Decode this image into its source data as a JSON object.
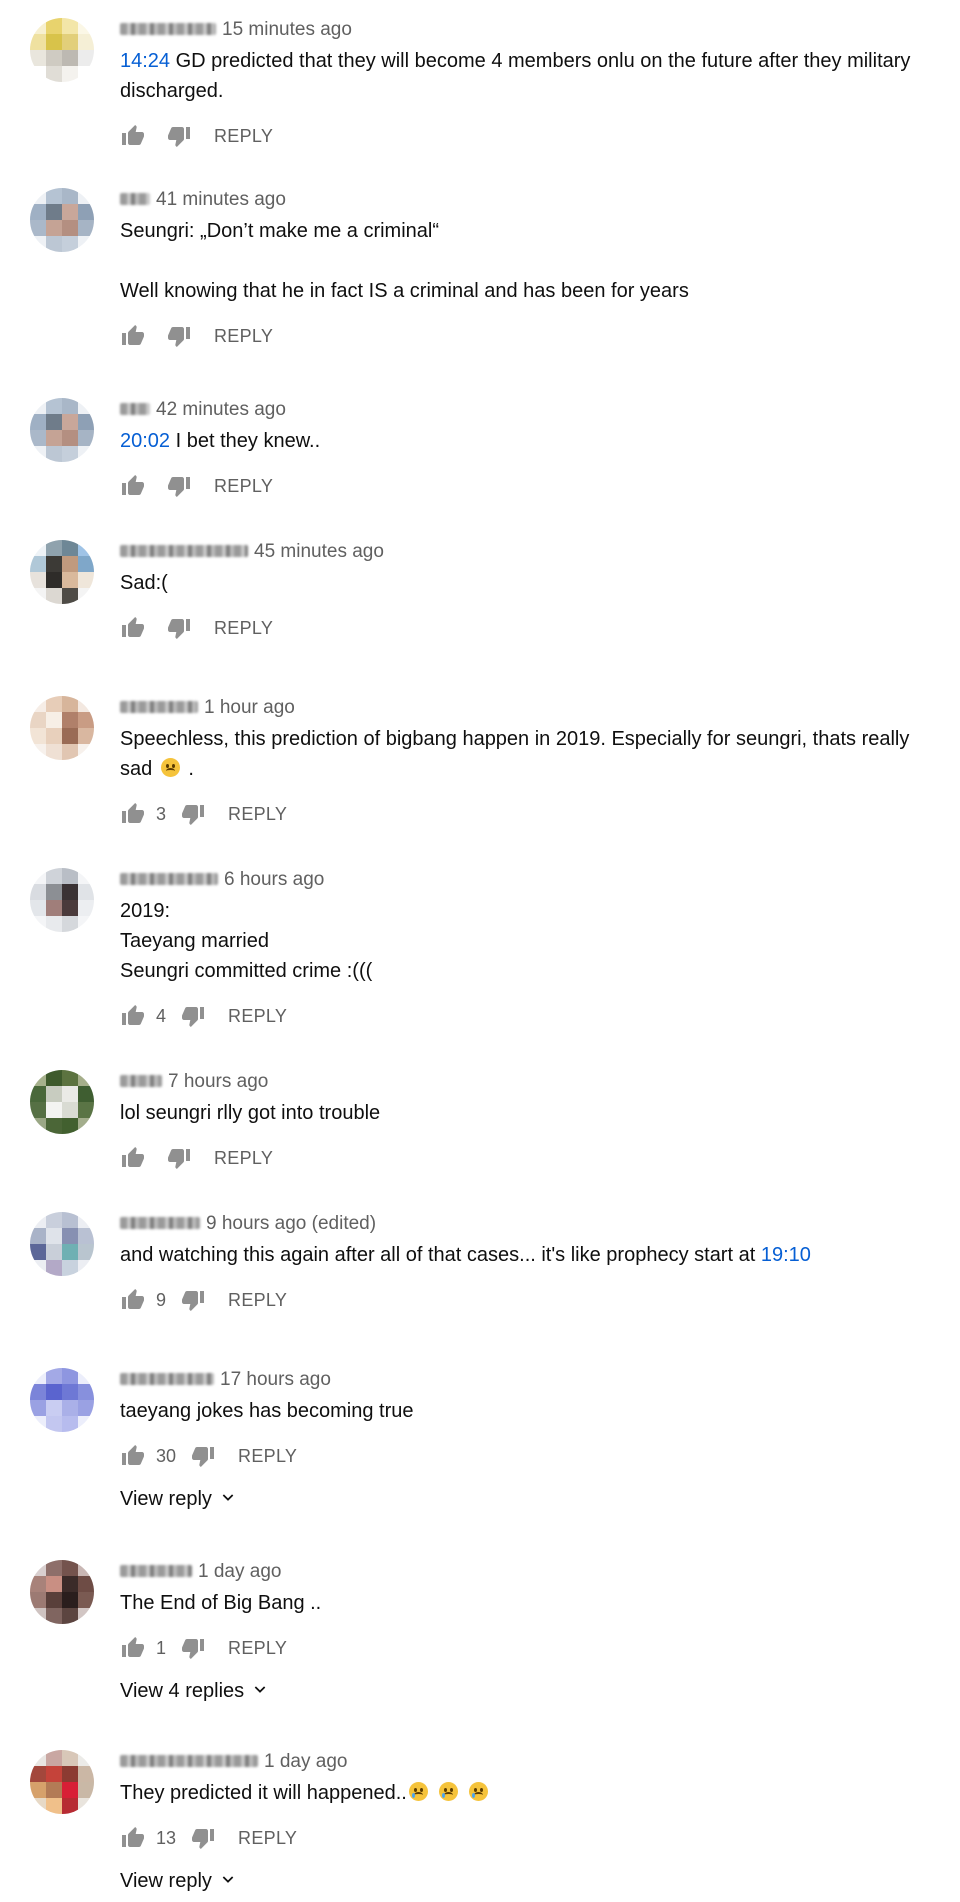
{
  "labels": {
    "reply": "REPLY"
  },
  "comments": [
    {
      "time": "15 minutes ago",
      "name_blur_width": 96,
      "avatar_palette": [
        "#f7f0cf",
        "#e8d36d",
        "#f3e6a8",
        "#fbf7e6",
        "#efe1a0",
        "#d8c34a",
        "#e2cf7a",
        "#f5efd6",
        "#e9e6dd",
        "#cfcbc2",
        "#bdb9b2",
        "#ececec",
        "#ffffff",
        "#e0ddd6",
        "#f4f2ee",
        "#ffffff"
      ],
      "lines": [
        {
          "ts": "14:24",
          "text": " GD predicted that they will become 4 members onlu on the future after they military discharged."
        }
      ],
      "likes": ""
    },
    {
      "time": "41 minutes ago",
      "name_blur_width": 30,
      "avatar_palette": [
        "#eef1f5",
        "#b5c3d3",
        "#a9b7c8",
        "#eef1f5",
        "#9fb0c4",
        "#6f7c8a",
        "#c9a79a",
        "#8ea0b5",
        "#aab8c9",
        "#c5a395",
        "#b48f81",
        "#a6b4c5",
        "#eef1f5",
        "#bcc7d4",
        "#c5cfdb",
        "#eef1f5"
      ],
      "lines": [
        {
          "text": "Seungri: „Don’t make me a criminal“"
        },
        {
          "blank": true
        },
        {
          "text": "Well knowing that he in fact IS a criminal and has been for years"
        }
      ],
      "likes": ""
    },
    {
      "time": "42 minutes ago",
      "name_blur_width": 30,
      "avatar_palette": [
        "#eef1f5",
        "#b5c3d3",
        "#a9b7c8",
        "#eef1f5",
        "#9fb0c4",
        "#6f7c8a",
        "#c9a79a",
        "#8ea0b5",
        "#aab8c9",
        "#c5a395",
        "#b48f81",
        "#a6b4c5",
        "#eef1f5",
        "#bcc7d4",
        "#c5cfdb",
        "#eef1f5"
      ],
      "lines": [
        {
          "ts": "20:02",
          "text": " I bet they knew.."
        }
      ],
      "likes": ""
    },
    {
      "time": "45 minutes ago",
      "name_blur_width": 128,
      "avatar_palette": [
        "#eef3f7",
        "#8fa2ad",
        "#6e8796",
        "#9fc3e6",
        "#b0c8d8",
        "#3c3a36",
        "#c09a7e",
        "#7fa7c9",
        "#e7e2dc",
        "#2e2c29",
        "#d9b99c",
        "#efe6da",
        "#f4f4f4",
        "#dcd8d2",
        "#4e4b46",
        "#f4f4f4"
      ],
      "lines": [
        {
          "text": "Sad:("
        }
      ],
      "likes": ""
    },
    {
      "time": "1 hour ago",
      "name_blur_width": 78,
      "avatar_palette": [
        "#f6ede6",
        "#e7cdb8",
        "#d7b59b",
        "#f3e8e0",
        "#e9d5c4",
        "#f7efe6",
        "#b0806a",
        "#c99c84",
        "#f2e4d6",
        "#e8d0bc",
        "#9a6b55",
        "#d9b7a0",
        "#f7f1ec",
        "#efe0d4",
        "#e1c6b2",
        "#f7f1ec"
      ],
      "lines": [
        {
          "text": "Speechless, this prediction of bigbang happen in 2019. Especially for seungri, thats really sad ",
          "emoji": "sad",
          "tail": " ."
        }
      ],
      "likes": "3"
    },
    {
      "time": "6 hours ago",
      "name_blur_width": 98,
      "avatar_palette": [
        "#f4f5f7",
        "#cfd3d9",
        "#b9bec6",
        "#f4f5f7",
        "#d9dce1",
        "#8c8f94",
        "#3a3234",
        "#e0e3e7",
        "#e3e6ea",
        "#a07e7a",
        "#4a3a3b",
        "#eceef1",
        "#f4f5f7",
        "#e8eaed",
        "#d5d8dc",
        "#f4f5f7"
      ],
      "lines": [
        {
          "text": "2019:"
        },
        {
          "text": "Taeyang married"
        },
        {
          "text": "Seungri committed crime :((("
        }
      ],
      "likes": "4"
    },
    {
      "time": "7 hours ago",
      "name_blur_width": 42,
      "avatar_palette": [
        "#a6b18c",
        "#3e5a2c",
        "#5c7340",
        "#a5ae8a",
        "#49683a",
        "#c8ccc0",
        "#eaeae6",
        "#3f5e31",
        "#567044",
        "#f4f4f2",
        "#d9dbd3",
        "#5a7445",
        "#9aa785",
        "#4b6637",
        "#42602f",
        "#a3ad8c"
      ],
      "lines": [
        {
          "text": "lol seungri rlly got into trouble"
        }
      ],
      "likes": ""
    },
    {
      "time": "9 hours ago (edited)",
      "name_blur_width": 80,
      "avatar_palette": [
        "#eceef3",
        "#c9cfdc",
        "#b8c0d2",
        "#eceef3",
        "#a9b3c8",
        "#dfe3ea",
        "#8790b2",
        "#b9c1d3",
        "#5c6798",
        "#c9cfd9",
        "#6fb0b3",
        "#b9c5cf",
        "#eceef3",
        "#b3a9c7",
        "#c8d2de",
        "#eceef3"
      ],
      "lines": [
        {
          "text": "and watching this again after all of that cases... it's like prophecy start at ",
          "ts_end": "19:10"
        }
      ],
      "likes": "9"
    },
    {
      "time": "17 hours ago",
      "name_blur_width": 94,
      "avatar_palette": [
        "#eceefb",
        "#a3a9e6",
        "#8e96e0",
        "#eceefb",
        "#7b84d9",
        "#5a64cf",
        "#6e78d5",
        "#8790dd",
        "#9aa1e3",
        "#c9cdf2",
        "#aab0e8",
        "#9aa1e3",
        "#eceefb",
        "#c3c7f0",
        "#b7bcee",
        "#eceefb"
      ],
      "lines": [
        {
          "text": "taeyang jokes has becoming true"
        }
      ],
      "likes": "30",
      "view_replies": "View reply"
    },
    {
      "time": "1 day ago",
      "name_blur_width": 72,
      "avatar_palette": [
        "#d9cfcf",
        "#8e6f6a",
        "#74534d",
        "#c9b7b4",
        "#a8827a",
        "#c98f83",
        "#3b2b29",
        "#6e4c45",
        "#9c7a73",
        "#593f3a",
        "#2a1e1d",
        "#7a5a52",
        "#cfc3c1",
        "#806560",
        "#5c4540",
        "#d2c6c4"
      ],
      "lines": [
        {
          "text": "The End of Big Bang .."
        }
      ],
      "likes": "1",
      "view_replies": "View 4 replies"
    },
    {
      "time": "1 day ago",
      "name_blur_width": 138,
      "avatar_palette": [
        "#e9e6e3",
        "#c9a7a2",
        "#d8c7b8",
        "#ecebe8",
        "#a3473c",
        "#c5433a",
        "#8c3b32",
        "#cbb7a5",
        "#d6a16b",
        "#b37b56",
        "#d81f36",
        "#c9b8a6",
        "#e7d9c6",
        "#f0c08a",
        "#b72b33",
        "#e9e4dd"
      ],
      "lines": [
        {
          "text": "They predicted it will happened..",
          "emoji_cry_count": 3
        }
      ],
      "likes": "13",
      "view_replies": "View reply"
    }
  ]
}
